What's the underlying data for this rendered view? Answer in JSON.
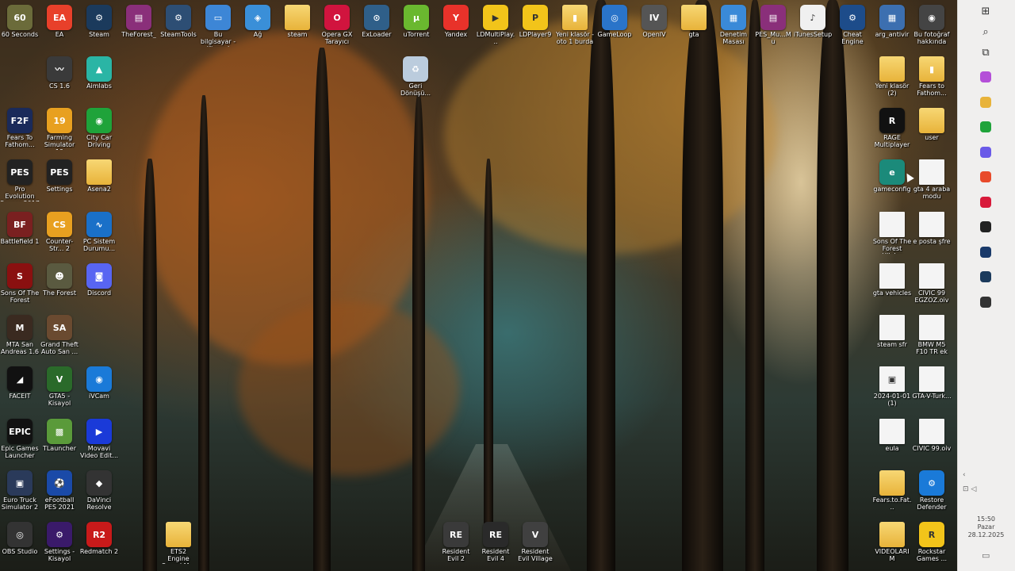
{
  "desktop": {
    "icons": [
      {
        "label": "60 Seconds",
        "icon": "60-seconds-icon",
        "color": "#6b6b3a",
        "glyph": "60"
      },
      {
        "label": "EA",
        "icon": "ea-icon",
        "color": "#e8402a",
        "glyph": "EA"
      },
      {
        "label": "Steam",
        "icon": "steam-icon",
        "color": "#1b3a5c",
        "glyph": "⚙"
      },
      {
        "label": "TheForest_",
        "icon": "winrar-icon",
        "color": "#8a2f7a",
        "glyph": "▤"
      },
      {
        "label": "SteamTools",
        "icon": "steamtools-icon",
        "color": "#2d4e74",
        "glyph": "⚙"
      },
      {
        "label": "Bu bilgisayar - Kisayol",
        "icon": "this-pc-icon",
        "color": "#3d86d6",
        "glyph": "▭"
      },
      {
        "label": "Ağ",
        "icon": "network-icon",
        "color": "#3a8fd8",
        "glyph": "◈"
      },
      {
        "label": "steam",
        "icon": "folder-icon",
        "color": "#e8b33a",
        "glyph": ""
      },
      {
        "label": "Opera GX Tarayıcı",
        "icon": "opera-gx-icon",
        "color": "#d1143e",
        "glyph": "O"
      },
      {
        "label": "ExLoader",
        "icon": "exloader-icon",
        "color": "#2f5f89",
        "glyph": "⊙"
      },
      {
        "label": "uTorrent",
        "icon": "utorrent-icon",
        "color": "#6ab82f",
        "glyph": "µ"
      },
      {
        "label": "Yandex",
        "icon": "yandex-icon",
        "color": "#e8322a",
        "glyph": "Y"
      },
      {
        "label": "LDMultiPlay...",
        "icon": "ldmultiplayer-icon",
        "color": "#f2c41a",
        "glyph": "▶"
      },
      {
        "label": "LDPlayer9",
        "icon": "ldplayer-icon",
        "color": "#f2c41a",
        "glyph": "P"
      },
      {
        "label": "Yeni klasör - oto 1 burda",
        "icon": "folder-zip-icon",
        "color": "#2a2a2a",
        "glyph": "▮"
      },
      {
        "label": "GameLoop",
        "icon": "gameloop-icon",
        "color": "#2a74c9",
        "glyph": "◎"
      },
      {
        "label": "OpenIV",
        "icon": "openiv-icon",
        "color": "#555",
        "glyph": "IV"
      },
      {
        "label": "gta",
        "icon": "folder-icon",
        "color": "#e8b33a",
        "glyph": ""
      },
      {
        "label": "Denetim Masası",
        "icon": "control-panel-icon",
        "color": "#3a8ad8",
        "glyph": "▦"
      },
      {
        "label": "PES_Mu...Mu",
        "icon": "winrar-icon",
        "color": "#8a2f7a",
        "glyph": "▤"
      },
      {
        "label": "iTunesSetup",
        "icon": "itunes-icon",
        "color": "#f0f0f0",
        "glyph": "♪"
      },
      {
        "label": "Cheat Engine",
        "icon": "cheat-engine-icon",
        "color": "#1d4c8a",
        "glyph": "⚙"
      },
      {
        "label": "arg_antivir",
        "icon": "antivirus-icon",
        "color": "#3c6fb0",
        "glyph": "▦"
      },
      {
        "label": "Bu fotoğraf hakkında",
        "icon": "camera-icon",
        "color": "#444",
        "glyph": "◉"
      },
      {
        "label": "CS 1.6",
        "icon": "cs16-icon",
        "color": "#3a3a3a",
        "glyph": "〰"
      },
      {
        "label": "Aimlabs",
        "icon": "aimlabs-icon",
        "color": "#2ab5a5",
        "glyph": "▲"
      },
      {
        "label": "Geri Dönüşü...",
        "icon": "recycle-bin-icon",
        "color": "#bcd",
        "glyph": "♻"
      },
      {
        "label": "Yeni klasör (2)",
        "icon": "folder-icon",
        "color": "#e8b33a",
        "glyph": ""
      },
      {
        "label": "Fears to Fathom...",
        "icon": "folder-zip-icon",
        "color": "#2a2a2a",
        "glyph": "▮"
      },
      {
        "label": "Fears To Fathom...",
        "icon": "f2f-icon",
        "color": "#1a2a5a",
        "glyph": "F2F"
      },
      {
        "label": "Farming Simulator 19",
        "icon": "farming-sim-icon",
        "color": "#e8a020",
        "glyph": "19"
      },
      {
        "label": "City Car Driving",
        "icon": "city-car-icon",
        "color": "#1fa33a",
        "glyph": "◉"
      },
      {
        "label": "RAGE Multiplayer",
        "icon": "rage-mp-icon",
        "color": "#111",
        "glyph": "R"
      },
      {
        "label": "user",
        "icon": "user-folder-icon",
        "color": "#e8b33a",
        "glyph": ""
      },
      {
        "label": "Pro Evolution Soccer 2017",
        "icon": "pes-icon",
        "color": "#222",
        "glyph": "PES"
      },
      {
        "label": "Settings",
        "icon": "pes-settings-icon",
        "color": "#222",
        "glyph": "PES"
      },
      {
        "label": "Asena2",
        "icon": "folder-icon",
        "color": "#e8b33a",
        "glyph": ""
      },
      {
        "label": "gameconfig",
        "icon": "edge-icon",
        "color": "#1b8a7a",
        "glyph": "e"
      },
      {
        "label": "gta 4 araba modu",
        "icon": "document-icon",
        "color": "#f4f4f4",
        "glyph": ""
      },
      {
        "label": "Battlefield 1",
        "icon": "battlefield-icon",
        "color": "#7a2020",
        "glyph": "BF"
      },
      {
        "label": "Counter-Str... 2",
        "icon": "cs2-icon",
        "color": "#e8a020",
        "glyph": "CS"
      },
      {
        "label": "PC Sistem Durumu...",
        "icon": "pc-health-icon",
        "color": "#1a70c8",
        "glyph": "∿"
      },
      {
        "label": "Sons Of The Forest Hileler",
        "icon": "document-icon",
        "color": "#f4f4f4",
        "glyph": ""
      },
      {
        "label": "e posta şfre",
        "icon": "document-icon",
        "color": "#f4f4f4",
        "glyph": ""
      },
      {
        "label": "Sons Of The Forest",
        "icon": "sons-forest-icon",
        "color": "#8a1010",
        "glyph": "S"
      },
      {
        "label": "The Forest",
        "icon": "the-forest-icon",
        "color": "#5a5a40",
        "glyph": "☻"
      },
      {
        "label": "Discord",
        "icon": "discord-icon",
        "color": "#5865f2",
        "glyph": "◙"
      },
      {
        "label": "gta vehicles",
        "icon": "document-icon",
        "color": "#f4f4f4",
        "glyph": ""
      },
      {
        "label": "CIVIC 99 EGZOZ.oiv",
        "icon": "document-icon",
        "color": "#f4f4f4",
        "glyph": ""
      },
      {
        "label": "MTA San Andreas 1.6",
        "icon": "mta-icon",
        "color": "#3a2a20",
        "glyph": "M"
      },
      {
        "label": "Grand Theft Auto San ...",
        "icon": "gta-sa-icon",
        "color": "#6a4a30",
        "glyph": "SA"
      },
      {
        "label": "steam sfr",
        "icon": "document-icon",
        "color": "#f4f4f4",
        "glyph": ""
      },
      {
        "label": "BMW M5 F10 TR ek",
        "icon": "document-icon",
        "color": "#f4f4f4",
        "glyph": ""
      },
      {
        "label": "FACEIT",
        "icon": "faceit-icon",
        "color": "#111",
        "glyph": "◢"
      },
      {
        "label": "GTA5 - Kisayol",
        "icon": "gta5-icon",
        "color": "#2a6a2a",
        "glyph": "V"
      },
      {
        "label": "iVCam",
        "icon": "ivcam-icon",
        "color": "#1a7ad8",
        "glyph": "◉"
      },
      {
        "label": "2024-01-01 (1)",
        "icon": "image-file-icon",
        "color": "#f4f4f4",
        "glyph": "▣"
      },
      {
        "label": "GTA-V-Turk...",
        "icon": "document-icon",
        "color": "#f4f4f4",
        "glyph": ""
      },
      {
        "label": "Epic Games Launcher",
        "icon": "epic-games-icon",
        "color": "#111",
        "glyph": "EPIC"
      },
      {
        "label": "TLauncher",
        "icon": "tlauncher-icon",
        "color": "#5a9a3a",
        "glyph": "▩"
      },
      {
        "label": "Movavi Video Edit...",
        "icon": "movavi-icon",
        "color": "#1a3ad8",
        "glyph": "▶"
      },
      {
        "label": "eula",
        "icon": "document-icon",
        "color": "#f4f4f4",
        "glyph": ""
      },
      {
        "label": "CIVIC 99.oiv",
        "icon": "document-icon",
        "color": "#f4f4f4",
        "glyph": ""
      },
      {
        "label": "Euro Truck Simulator 2",
        "icon": "ets2-icon",
        "color": "#2a3a5a",
        "glyph": "▣"
      },
      {
        "label": "eFootball PES 2021",
        "icon": "efootball-icon",
        "color": "#1a4aa8",
        "glyph": "⚽"
      },
      {
        "label": "DaVinci Resolve",
        "icon": "davinci-icon",
        "color": "#333",
        "glyph": "◆"
      },
      {
        "label": "Fears.to.Fat...",
        "icon": "folder-icon",
        "color": "#e8b33a",
        "glyph": ""
      },
      {
        "label": "Restore Defender",
        "icon": "restore-defender-icon",
        "color": "#1a7ad8",
        "glyph": "⚙"
      },
      {
        "label": "OBS Studio",
        "icon": "obs-icon",
        "color": "#333",
        "glyph": "◎"
      },
      {
        "label": "Settings - Kisayol",
        "icon": "pes-settings-shortcut-icon",
        "color": "#3a1a6a",
        "glyph": "⚙"
      },
      {
        "label": "Redmatch 2",
        "icon": "redmatch-icon",
        "color": "#c81a1a",
        "glyph": "R2"
      },
      {
        "label": "ETS2 Engine Sound M...",
        "icon": "folder-icon",
        "color": "#e8b33a",
        "glyph": ""
      },
      {
        "label": "Resident Evil 2",
        "icon": "re2-icon",
        "color": "#3a3a3a",
        "glyph": "RE"
      },
      {
        "label": "Resident Evil 4",
        "icon": "re4-icon",
        "color": "#2a2a2a",
        "glyph": "RE"
      },
      {
        "label": "Resident Evil Village",
        "icon": "re-village-icon",
        "color": "#404040",
        "glyph": "V"
      },
      {
        "label": "VIDEOLARIM",
        "icon": "folder-icon",
        "color": "#e8b33a",
        "glyph": ""
      },
      {
        "label": "Rockstar Games ...",
        "icon": "rockstar-icon",
        "color": "#f2c41a",
        "glyph": "R"
      }
    ]
  },
  "side_rail": {
    "buttons": [
      {
        "icon": "windows-start-icon",
        "glyph": "⊞"
      },
      {
        "icon": "search-icon",
        "glyph": "⌕"
      },
      {
        "icon": "task-view-icon",
        "glyph": "⧉"
      }
    ],
    "apps": [
      {
        "icon": "copilot-app-icon",
        "color": "#b44fd8"
      },
      {
        "icon": "file-explorer-app-icon",
        "color": "#e8b33a"
      },
      {
        "icon": "calendar-app-icon",
        "color": "#1fa33a"
      },
      {
        "icon": "browser-app-icon",
        "color": "#6a5ae8"
      },
      {
        "icon": "chrome-app-icon",
        "color": "#e84a2a"
      },
      {
        "icon": "red-app-icon",
        "color": "#d81a3a"
      },
      {
        "icon": "dark-app-icon",
        "color": "#222"
      },
      {
        "icon": "blue-app-icon",
        "color": "#1a3a6a"
      },
      {
        "icon": "steam-app-icon",
        "color": "#1b3a5c"
      },
      {
        "icon": "obs-app-icon",
        "color": "#333"
      }
    ],
    "tray": {
      "chevron": "‹",
      "notification_glyph": "▭"
    },
    "clock": {
      "time": "15:50",
      "day": "Pazar",
      "date": "28.12.2025"
    }
  }
}
